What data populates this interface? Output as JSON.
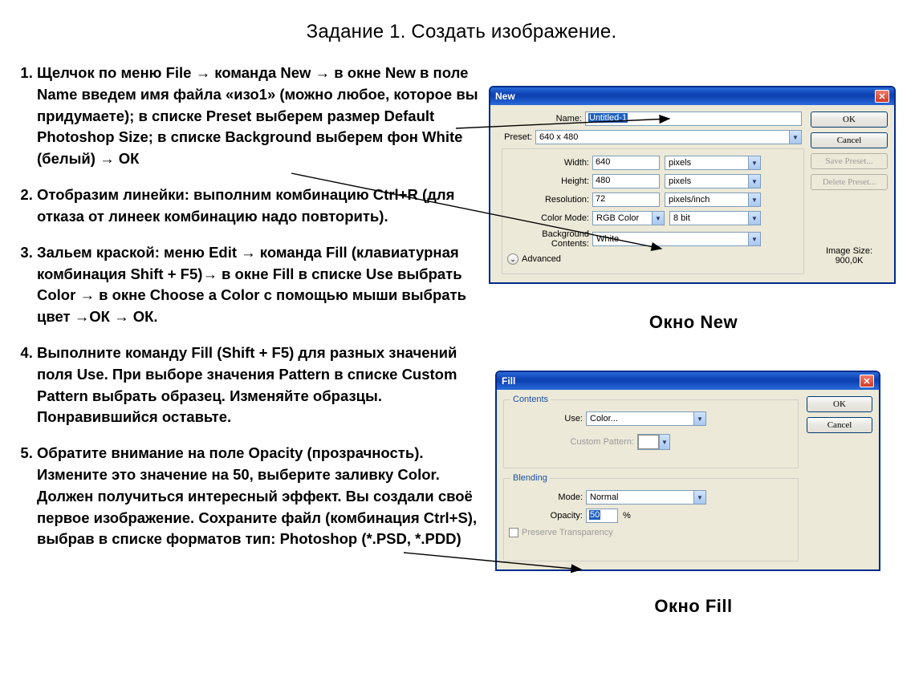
{
  "title": "Задание 1. Создать изображение.",
  "steps": [
    "Щелчок по меню File → команда New → в окне New в поле Name введем имя файла «изо1» (можно любое, которое вы придумаете); в списке Preset выберем размер Default Photoshop Size; в списке Background выберем фон White (белый) → ОК",
    "Отобразим линейки: выполним комбинацию Ctrl+R  (для отказа от линеек комбинацию надо повторить).",
    "Зальем краской: меню Edit → команда Fill (клавиатурная комбинация Shift + F5)→ в окне Fill в списке Use выбрать Color → в окне Choose a Color с помощью мыши выбрать цвет →ОК → ОК.",
    "Выполните команду Fill (Shift + F5) для разных значений поля Use. При выборе значения Pattern в списке Custom Pattern выбрать образец. Изменяйте образцы. Понравившийся оставьте.",
    "Обратите внимание на поле Opacity (прозрачность). Измените это значение на 50, выберите заливку Color. Должен получиться интересный эффект. Вы создали своё первое изображение. Сохраните файл (комбинация Ctrl+S), выбрав в списке форматов тип: Photoshop (*.PSD, *.PDD)"
  ],
  "newDialog": {
    "title": "New",
    "name_label": "Name:",
    "name_value": "Untitled-1",
    "preset_label": "Preset:",
    "preset_value": "640 x 480",
    "width_label": "Width:",
    "width_value": "640",
    "width_unit": "pixels",
    "height_label": "Height:",
    "height_value": "480",
    "height_unit": "pixels",
    "resolution_label": "Resolution:",
    "resolution_value": "72",
    "resolution_unit": "pixels/inch",
    "colormode_label": "Color Mode:",
    "colormode_value": "RGB Color",
    "colormode_depth": "8 bit",
    "bg_label": "Background Contents:",
    "bg_value": "White",
    "advanced_label": "Advanced",
    "imagesize_label": "Image Size:",
    "imagesize_value": "900,0K",
    "btn_ok": "OK",
    "btn_cancel": "Cancel",
    "btn_save": "Save Preset...",
    "btn_delete": "Delete Preset..."
  },
  "caption_new": "Окно  New",
  "fillDialog": {
    "title": "Fill",
    "contents_label": "Contents",
    "use_label": "Use:",
    "use_value": "Color...",
    "custom_label": "Custom Pattern:",
    "blending_label": "Blending",
    "mode_label": "Mode:",
    "mode_value": "Normal",
    "opacity_label": "Opacity:",
    "opacity_value": "50",
    "opacity_suffix": "%",
    "preserve_label": "Preserve Transparency",
    "btn_ok": "OK",
    "btn_cancel": "Cancel"
  },
  "caption_fill": "Окно  Fill"
}
